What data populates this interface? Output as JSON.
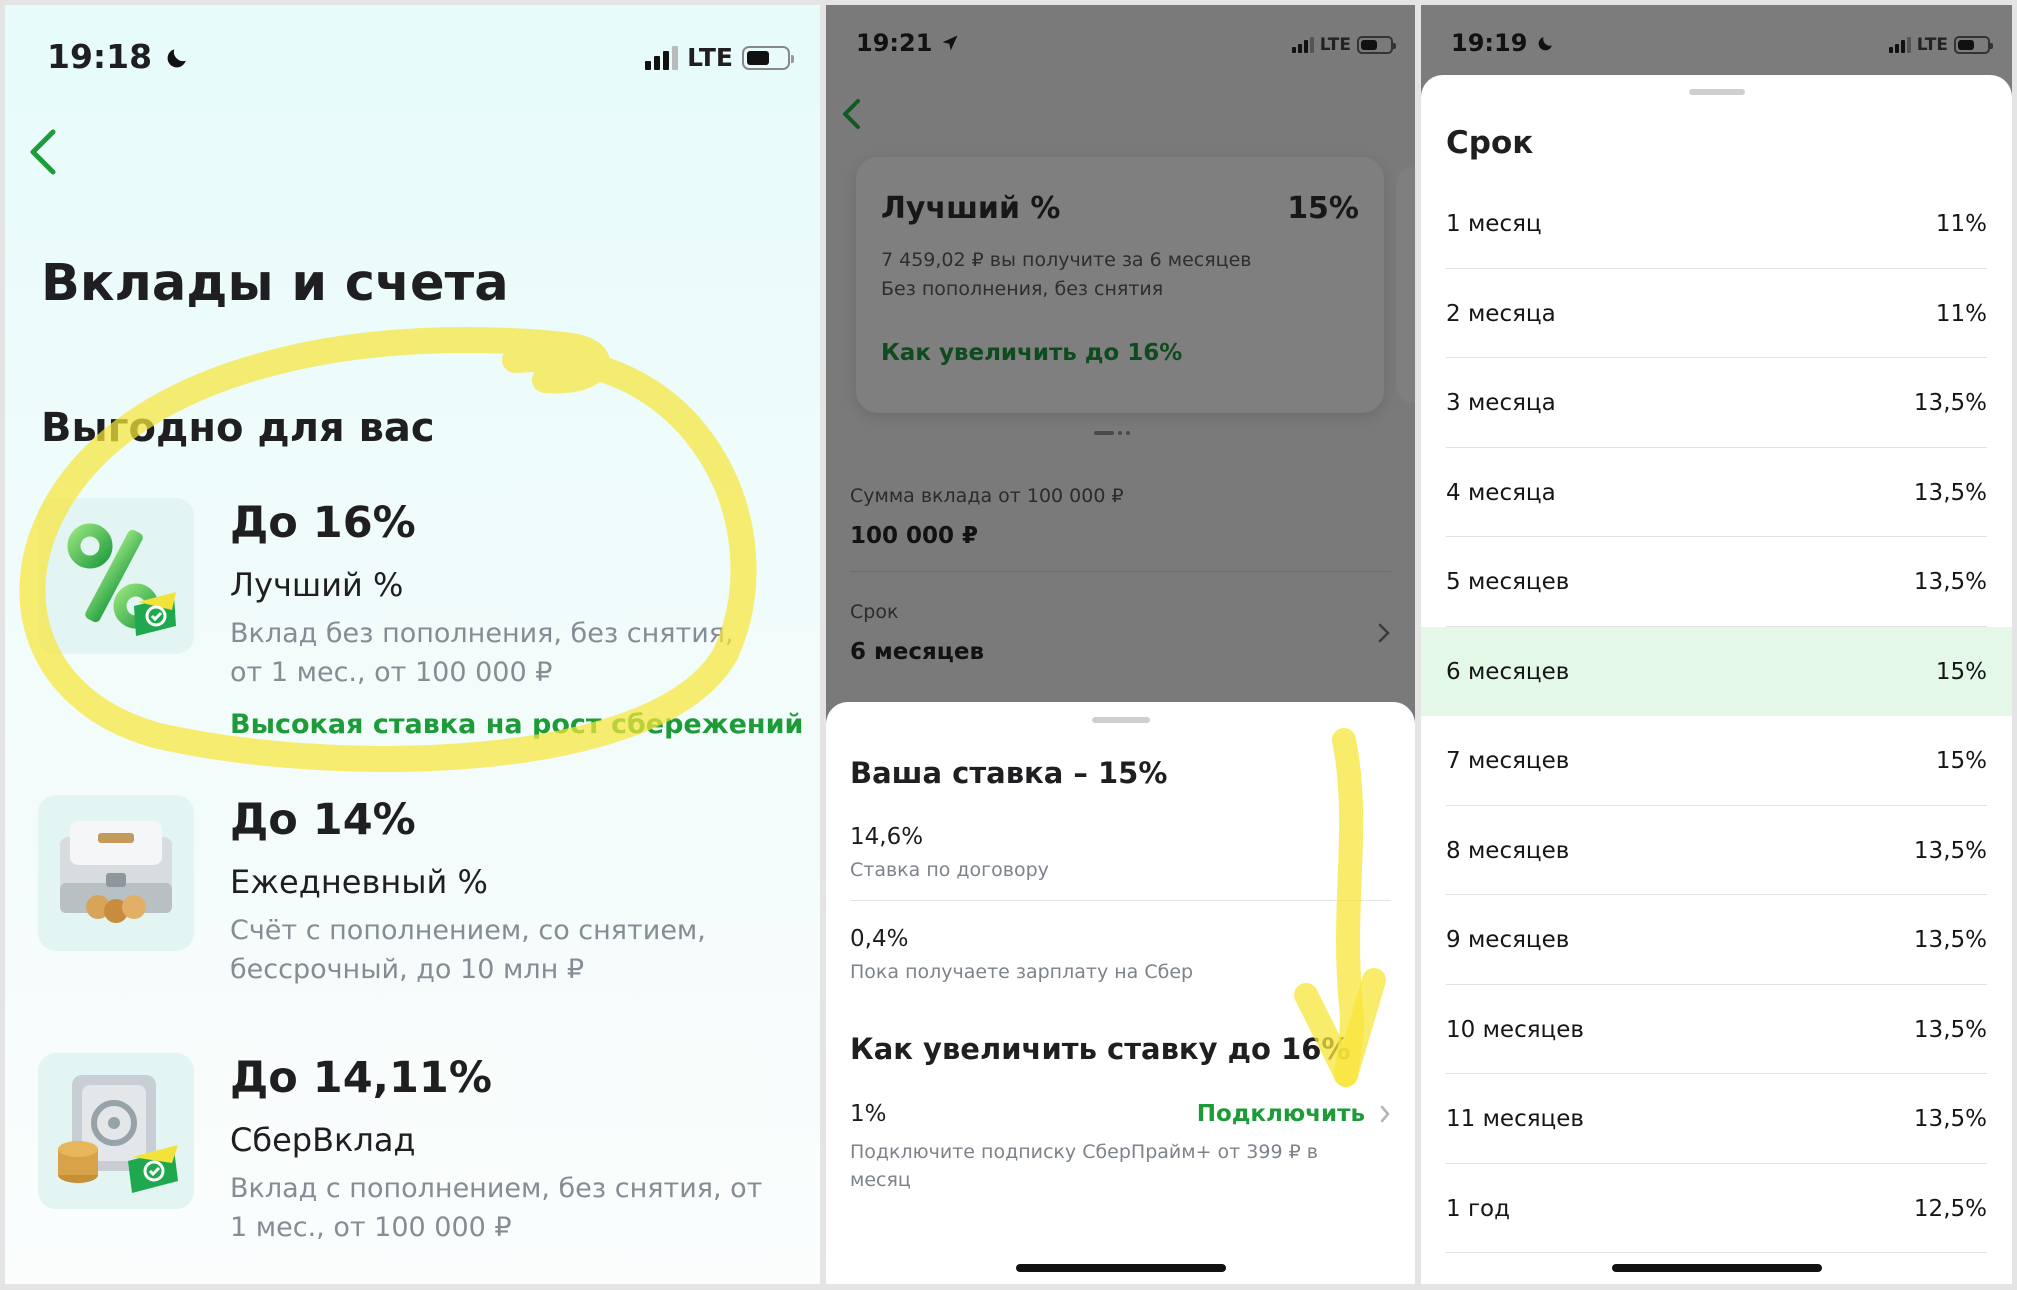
{
  "panel1": {
    "status": {
      "time": "19:18",
      "network": "LTE"
    },
    "title": "Вклады и счета",
    "section": "Выгодно для вас",
    "offers": [
      {
        "rate": "До 16%",
        "name": "Лучший %",
        "desc": "Вклад без пополнения, без снятия, от 1 мес., от 100 000 ₽",
        "promo": "Высокая ставка на рост сбережений"
      },
      {
        "rate": "До 14%",
        "name": "Ежедневный %",
        "desc": "Счёт с пополнением, со снятием, бессрочный, до 10 млн ₽"
      },
      {
        "rate": "До 14,11%",
        "name": "СберВклад",
        "desc": "Вклад с пополнением, без снятия, от 1 мес., от 100 000 ₽"
      }
    ]
  },
  "panel2": {
    "status": {
      "time": "19:21",
      "network": "LTE"
    },
    "card": {
      "title": "Лучший %",
      "percent": "15%",
      "line1": "7 459,02 ₽ вы получите за 6 месяцев",
      "line2": "Без пополнения, без снятия",
      "link": "Как увеличить до 16%"
    },
    "amount": {
      "label": "Сумма вклада от 100 000 ₽",
      "value": "100 000 ₽"
    },
    "term": {
      "label": "Срок",
      "value": "6 месяцев"
    },
    "sheet": {
      "title": "Ваша ставка – 15%",
      "rows": [
        {
          "value": "14,6%",
          "label": "Ставка по договору"
        },
        {
          "value": "0,4%",
          "label": "Пока получаете зарплату на Сбер"
        }
      ],
      "increase_title": "Как увеличить ставку до 16%",
      "increase_value": "1%",
      "connect": "Подключить",
      "increase_desc": "Подключите подписку СберПрайм+ от 399 ₽ в месяц"
    }
  },
  "panel3": {
    "status": {
      "time": "19:19",
      "network": "LTE"
    },
    "title": "Срок",
    "terms": [
      {
        "label": "1 месяц",
        "rate": "11%"
      },
      {
        "label": "2 месяца",
        "rate": "11%"
      },
      {
        "label": "3 месяца",
        "rate": "13,5%"
      },
      {
        "label": "4 месяца",
        "rate": "13,5%"
      },
      {
        "label": "5 месяцев",
        "rate": "13,5%"
      },
      {
        "label": "6 месяцев",
        "rate": "15%",
        "selected": true
      },
      {
        "label": "7 месяцев",
        "rate": "15%"
      },
      {
        "label": "8 месяцев",
        "rate": "13,5%"
      },
      {
        "label": "9 месяцев",
        "rate": "13,5%"
      },
      {
        "label": "10 месяцев",
        "rate": "13,5%"
      },
      {
        "label": "11 месяцев",
        "rate": "13,5%"
      },
      {
        "label": "1 год",
        "rate": "12,5%"
      }
    ]
  },
  "colors": {
    "accent_green": "#1d9b38",
    "highlight_row": "#e3f8e6",
    "highlighter": "#f7e63a"
  }
}
